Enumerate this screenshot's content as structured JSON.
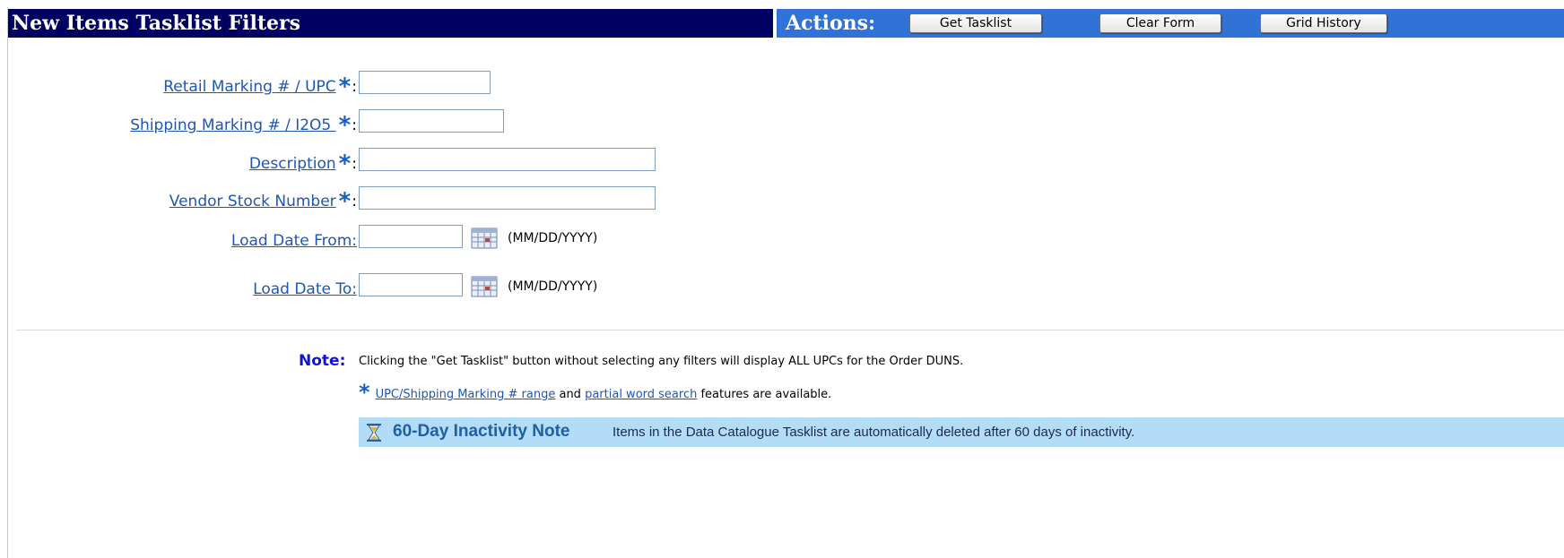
{
  "header": {
    "title": "New Items Tasklist Filters",
    "actions_label": "Actions:",
    "buttons": {
      "get_tasklist": "Get Tasklist",
      "clear_form": "Clear Form",
      "grid_history": "Grid History"
    }
  },
  "form": {
    "retail_marking": {
      "label": "Retail Marking # / UPC",
      "value": "",
      "colon": ":"
    },
    "shipping_marking": {
      "label": "Shipping Marking # / I2O5 ",
      "value": "",
      "colon": ":"
    },
    "description": {
      "label": "Description",
      "value": "",
      "colon": ":"
    },
    "vendor_stock": {
      "label": "Vendor Stock Number",
      "value": "",
      "colon": ":"
    },
    "load_date_from": {
      "label": "Load Date From:",
      "value": "",
      "hint": "(MM/DD/YYYY)"
    },
    "load_date_to": {
      "label": "Load Date To:",
      "value": "",
      "hint": "(MM/DD/YYYY)"
    },
    "required_marker": "*"
  },
  "notes": {
    "note_label": "Note:",
    "note_text": "Clicking the \"Get Tasklist\" button without selecting any filters will display ALL UPCs for the Order DUNS.",
    "features": {
      "link1": "UPC/Shipping Marking # range",
      "middle": " and ",
      "link2": "partial word search",
      "end": " features are available."
    },
    "inactivity": {
      "icon": "hourglass-icon",
      "title": "60-Day Inactivity Note",
      "text": "Items in the Data Catalogue Tasklist are automatically deleted after 60 days of inactivity."
    }
  },
  "colors": {
    "title_bar": "#000063",
    "actions_bar": "#3072d6",
    "link": "#1f56b4",
    "note_label": "#1212d6",
    "inactivity_bg": "#b3ddf6"
  }
}
